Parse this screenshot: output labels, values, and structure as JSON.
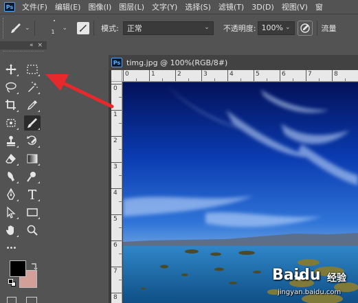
{
  "menubar": {
    "logo": "Ps",
    "items": [
      "文件(F)",
      "编辑(E)",
      "图像(I)",
      "图层(L)",
      "文字(Y)",
      "选择(S)",
      "滤镜(T)",
      "3D(D)",
      "视图(V)",
      "窗"
    ]
  },
  "options": {
    "brush_size": "1",
    "mode_label": "模式:",
    "mode_value": "正常",
    "opacity_label": "不透明度:",
    "opacity_value": "100%",
    "flow_label": "流量"
  },
  "toolbox": {
    "collapse_icon": "«",
    "close_icon": "×",
    "more_icon": "•••"
  },
  "document": {
    "logo": "Ps",
    "title": "timg.jpg @ 100%(RGB/8#)",
    "ruler_h": [
      "0",
      "1",
      "2",
      "3",
      "4",
      "5",
      "6",
      "7",
      "8"
    ],
    "ruler_v": [
      "0",
      "1",
      "2",
      "3",
      "4",
      "5",
      "6",
      "7",
      "8"
    ]
  },
  "watermark": {
    "brand": "Baidu",
    "suffix": "经验",
    "url": "jingyan.baidu.com"
  },
  "colors": {
    "foreground": "#000000",
    "background": "#d2a099",
    "annotation_arrow": "#e8292b"
  }
}
